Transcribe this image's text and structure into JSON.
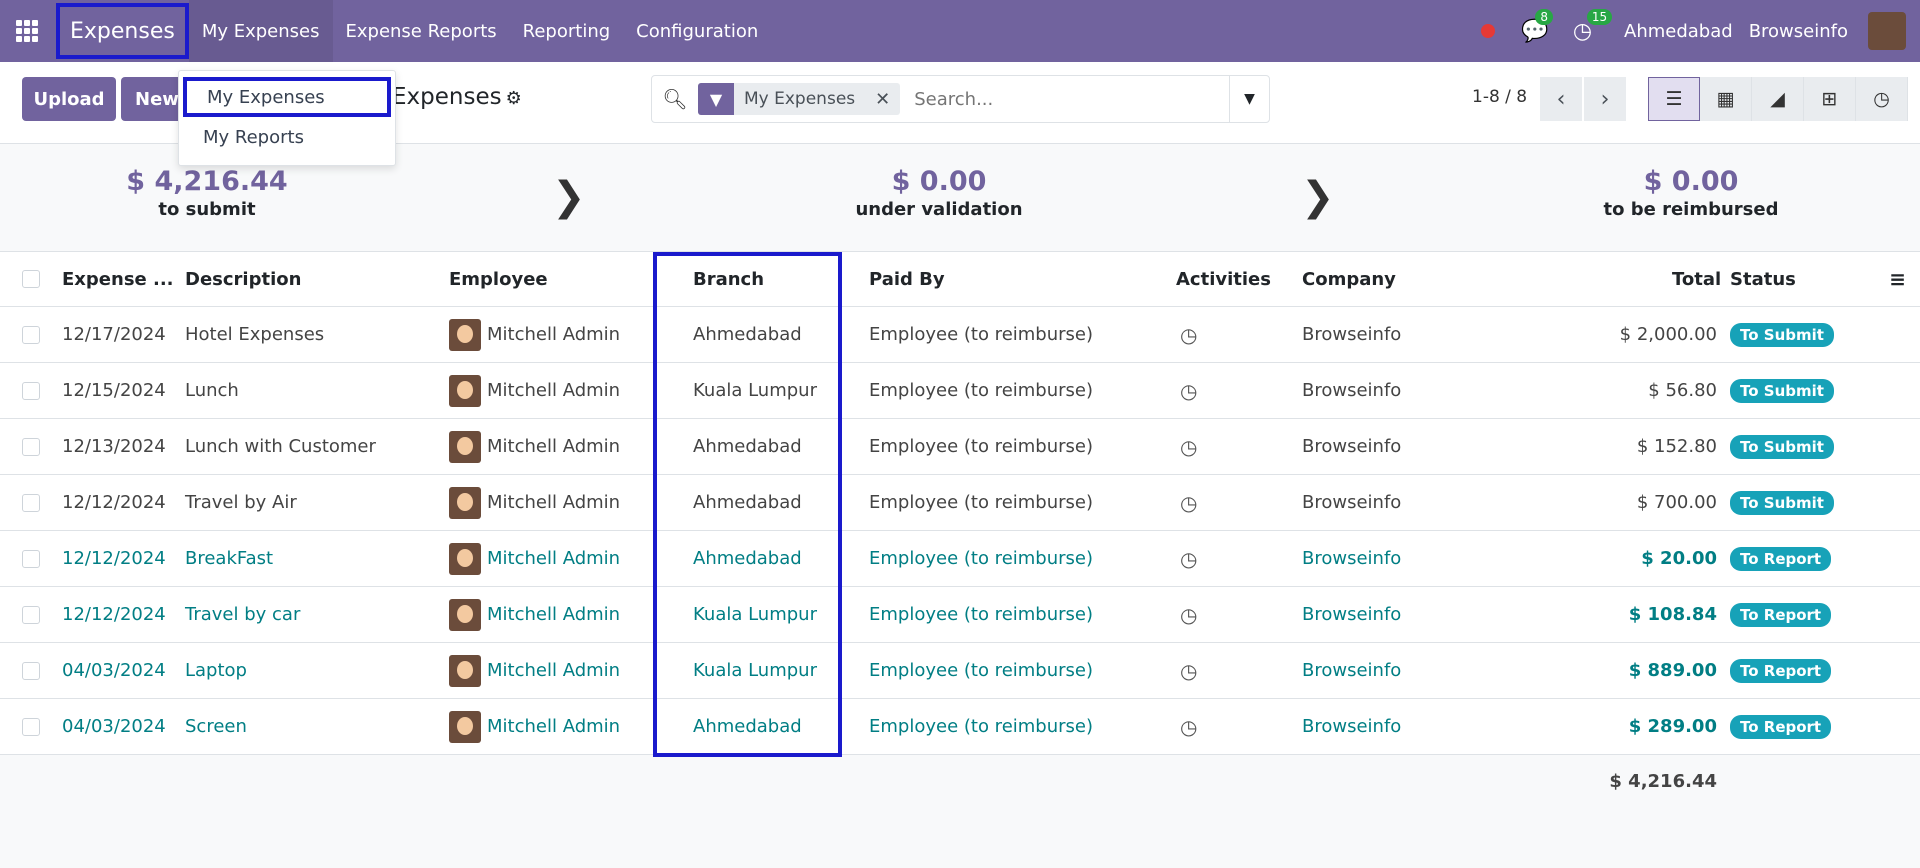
{
  "navbar": {
    "app_name": "Expenses",
    "menu": [
      "My Expenses",
      "Expense Reports",
      "Reporting",
      "Configuration"
    ],
    "messages_count": "8",
    "activities_count": "15",
    "branch": "Ahmedabad",
    "company": "Browseinfo"
  },
  "toolbar": {
    "upload_label": "Upload",
    "new_label": "New",
    "title": "Expenses"
  },
  "dropdown": {
    "items": [
      "My Expenses",
      "My Reports"
    ]
  },
  "search": {
    "facet": "My Expenses",
    "placeholder": "Search..."
  },
  "pager": {
    "value": "1-8 / 8"
  },
  "summary": [
    {
      "amount": "$ 4,216.44",
      "label": "to submit"
    },
    {
      "amount": "$ 0.00",
      "label": "under validation"
    },
    {
      "amount": "$ 0.00",
      "label": "to be reimbursed"
    }
  ],
  "table": {
    "headers": {
      "date": "Expense ...",
      "description": "Description",
      "employee": "Employee",
      "branch": "Branch",
      "paid_by": "Paid By",
      "activities": "Activities",
      "company": "Company",
      "total": "Total",
      "status": "Status"
    },
    "rows": [
      {
        "date": "12/17/2024",
        "description": "Hotel Expenses",
        "employee": "Mitchell Admin",
        "branch": "Ahmedabad",
        "paid_by": "Employee (to reimburse)",
        "company": "Browseinfo",
        "total": "$ 2,000.00",
        "status": "To Submit"
      },
      {
        "date": "12/15/2024",
        "description": "Lunch",
        "employee": "Mitchell Admin",
        "branch": "Kuala Lumpur",
        "paid_by": "Employee (to reimburse)",
        "company": "Browseinfo",
        "total": "$ 56.80",
        "status": "To Submit"
      },
      {
        "date": "12/13/2024",
        "description": "Lunch with Customer",
        "employee": "Mitchell Admin",
        "branch": "Ahmedabad",
        "paid_by": "Employee (to reimburse)",
        "company": "Browseinfo",
        "total": "$ 152.80",
        "status": "To Submit"
      },
      {
        "date": "12/12/2024",
        "description": "Travel by Air",
        "employee": "Mitchell Admin",
        "branch": "Ahmedabad",
        "paid_by": "Employee (to reimburse)",
        "company": "Browseinfo",
        "total": "$ 700.00",
        "status": "To Submit"
      },
      {
        "date": "12/12/2024",
        "description": "BreakFast",
        "employee": "Mitchell Admin",
        "branch": "Ahmedabad",
        "paid_by": "Employee (to reimburse)",
        "company": "Browseinfo",
        "total": "$ 20.00",
        "status": "To Report"
      },
      {
        "date": "12/12/2024",
        "description": "Travel by car",
        "employee": "Mitchell Admin",
        "branch": "Kuala Lumpur",
        "paid_by": "Employee (to reimburse)",
        "company": "Browseinfo",
        "total": "$ 108.84",
        "status": "To Report"
      },
      {
        "date": "04/03/2024",
        "description": "Laptop",
        "employee": "Mitchell Admin",
        "branch": "Kuala Lumpur",
        "paid_by": "Employee (to reimburse)",
        "company": "Browseinfo",
        "total": "$ 889.00",
        "status": "To Report"
      },
      {
        "date": "04/03/2024",
        "description": "Screen",
        "employee": "Mitchell Admin",
        "branch": "Ahmedabad",
        "paid_by": "Employee (to reimburse)",
        "company": "Browseinfo",
        "total": "$ 289.00",
        "status": "To Report"
      }
    ],
    "grand_total": "$ 4,216.44"
  },
  "colors": {
    "brand": "#71639e",
    "link": "#017e84",
    "status": "#17a2b8",
    "highlight": "#1a1acc"
  }
}
